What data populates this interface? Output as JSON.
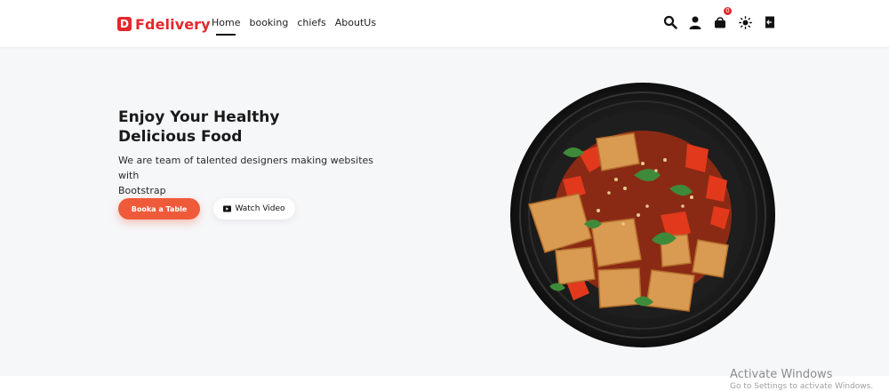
{
  "brand": {
    "badge": "D",
    "name": "Fdelivery",
    "color": "#e5272c"
  },
  "nav": {
    "links": [
      {
        "label": "Home",
        "active": true
      },
      {
        "label": "booking",
        "active": false
      },
      {
        "label": "chiefs",
        "active": false
      },
      {
        "label": "AboutUs",
        "active": false
      }
    ],
    "icons": [
      "search-icon",
      "user-icon",
      "cart-icon",
      "theme-sun-icon",
      "logout-door-icon"
    ],
    "cart_count": "0"
  },
  "hero": {
    "title_line1": "Enjoy Your Healthy",
    "title_line2": "Delicious Food",
    "subtitle_line1": "We are team of talented designers making websites with",
    "subtitle_line2": "Bootstrap",
    "book_button": "Booka a Table",
    "video_button": "Watch Video",
    "accent": "#ef5b3a"
  },
  "os_watermark": {
    "title": "Activate Windows",
    "subtitle": "Go to Settings to activate Windows."
  }
}
